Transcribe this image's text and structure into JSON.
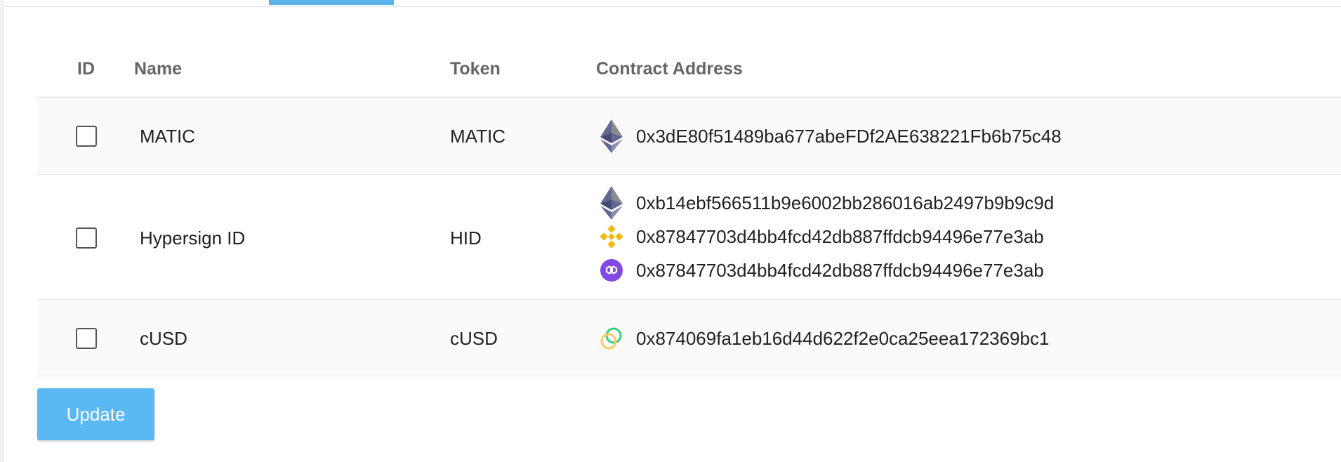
{
  "table": {
    "headers": {
      "id": "ID",
      "name": "Name",
      "token": "Token",
      "contract_address": "Contract Address"
    },
    "rows": [
      {
        "checked": false,
        "name": "MATIC",
        "token": "MATIC",
        "addresses": [
          {
            "chain_icon": "ethereum-icon",
            "address": "0x3dE80f51489ba677abeFDf2AE638221Fb6b75c48"
          }
        ]
      },
      {
        "checked": false,
        "name": "Hypersign ID",
        "token": "HID",
        "addresses": [
          {
            "chain_icon": "ethereum-icon",
            "address": "0xb14ebf566511b9e6002bb286016ab2497b9b9c9d"
          },
          {
            "chain_icon": "binance-icon",
            "address": "0x87847703d4bb4fcd42db887ffdcb94496e77e3ab"
          },
          {
            "chain_icon": "polygon-icon",
            "address": "0x87847703d4bb4fcd42db887ffdcb94496e77e3ab"
          }
        ]
      },
      {
        "checked": false,
        "name": "cUSD",
        "token": "cUSD",
        "addresses": [
          {
            "chain_icon": "celo-icon",
            "address": "0x874069fa1eb16d44d622f2e0ca25eea172369bc1"
          }
        ]
      }
    ]
  },
  "actions": {
    "update_label": "Update"
  },
  "colors": {
    "accent": "#5ab8f4",
    "tab_indicator": "#5ab2ea",
    "binance": "#f0b90b",
    "polygon": "#8247e5",
    "celo_green": "#35d07f",
    "celo_gold": "#fbcc5c"
  }
}
